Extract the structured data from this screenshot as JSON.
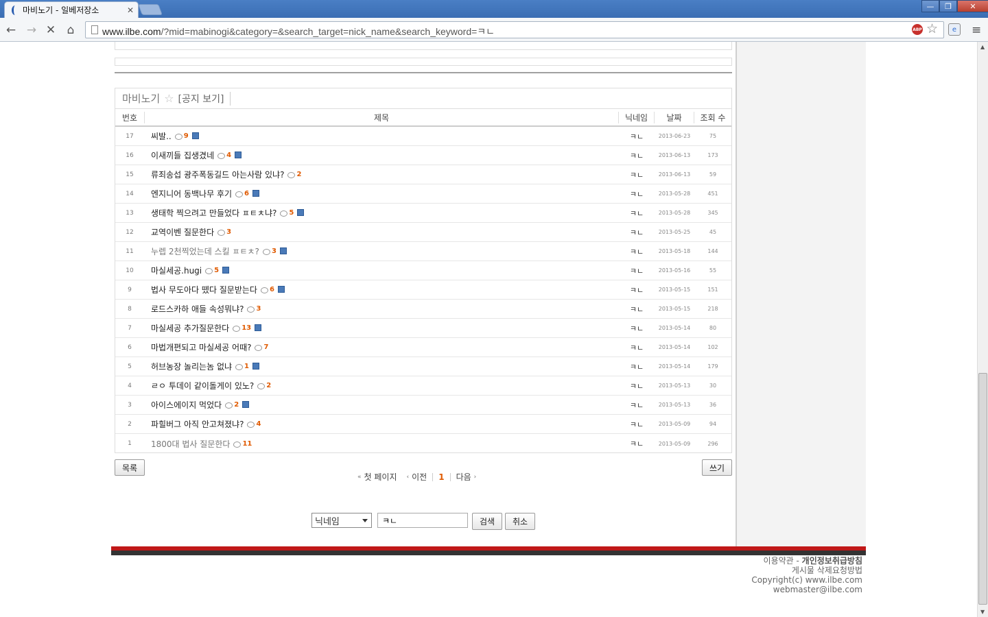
{
  "browser": {
    "tab_title": "마비노기 - 일베저장소",
    "tab_close": "✕",
    "url_host": "www.ilbe.com",
    "url_rest": "/?mid=mabinogi&category=&search_target=nick_name&search_keyword=ㅋㄴ",
    "abp_label": "ABP",
    "window_controls": [
      "—",
      "❐",
      "✕"
    ]
  },
  "board": {
    "name": "마비노기",
    "notice_link": "[공지 보기]",
    "columns": {
      "no": "번호",
      "title": "제목",
      "nick": "닉네임",
      "date": "날짜",
      "views": "조회 수"
    },
    "rows": [
      {
        "no": "17",
        "title": "씨발..",
        "comments": "9",
        "file": true,
        "nick": "ㅋㄴ",
        "date": "2013-06-23",
        "views": "75",
        "visited": false
      },
      {
        "no": "16",
        "title": "이새끼들 집생겼네",
        "comments": "4",
        "file": true,
        "nick": "ㅋㄴ",
        "date": "2013-06-13",
        "views": "173",
        "visited": false
      },
      {
        "no": "15",
        "title": "류죄송섭 광주폭동길드 아는사람 있냐?",
        "comments": "2",
        "file": false,
        "nick": "ㅋㄴ",
        "date": "2013-06-13",
        "views": "59",
        "visited": false
      },
      {
        "no": "14",
        "title": "엔지니어 동백나무 후기",
        "comments": "6",
        "file": true,
        "nick": "ㅋㄴ",
        "date": "2013-05-28",
        "views": "451",
        "visited": false
      },
      {
        "no": "13",
        "title": "생태학 찍으려고 만들었다 ㅍㅌㅊ냐?",
        "comments": "5",
        "file": true,
        "nick": "ㅋㄴ",
        "date": "2013-05-28",
        "views": "345",
        "visited": false
      },
      {
        "no": "12",
        "title": "교역이벤 질문한다",
        "comments": "3",
        "file": false,
        "nick": "ㅋㄴ",
        "date": "2013-05-25",
        "views": "45",
        "visited": false
      },
      {
        "no": "11",
        "title": "누렙 2천찍었는데 스킬 ㅍㅌㅊ?",
        "comments": "3",
        "file": true,
        "nick": "ㅋㄴ",
        "date": "2013-05-18",
        "views": "144",
        "visited": true
      },
      {
        "no": "10",
        "title": "마실세공.hugi",
        "comments": "5",
        "file": true,
        "nick": "ㅋㄴ",
        "date": "2013-05-16",
        "views": "55",
        "visited": false
      },
      {
        "no": "9",
        "title": "법사 무도아다 뗐다 질문받는다",
        "comments": "6",
        "file": true,
        "nick": "ㅋㄴ",
        "date": "2013-05-15",
        "views": "151",
        "visited": false
      },
      {
        "no": "8",
        "title": "로드스카하 애들 속성뭐냐?",
        "comments": "3",
        "file": false,
        "nick": "ㅋㄴ",
        "date": "2013-05-15",
        "views": "218",
        "visited": false
      },
      {
        "no": "7",
        "title": "마실세공 추가질문한다",
        "comments": "13",
        "file": true,
        "nick": "ㅋㄴ",
        "date": "2013-05-14",
        "views": "80",
        "visited": false
      },
      {
        "no": "6",
        "title": "마법개편되고 마실세공 어때?",
        "comments": "7",
        "file": false,
        "nick": "ㅋㄴ",
        "date": "2013-05-14",
        "views": "102",
        "visited": false
      },
      {
        "no": "5",
        "title": "허브농장 놀리는놈 없냐",
        "comments": "1",
        "file": true,
        "nick": "ㅋㄴ",
        "date": "2013-05-14",
        "views": "179",
        "visited": false
      },
      {
        "no": "4",
        "title": "ㄹㅇ 투데이 같이돌게이 있노?",
        "comments": "2",
        "file": false,
        "nick": "ㅋㄴ",
        "date": "2013-05-13",
        "views": "30",
        "visited": false
      },
      {
        "no": "3",
        "title": "아이스에이지 먹었다",
        "comments": "2",
        "file": true,
        "nick": "ㅋㄴ",
        "date": "2013-05-13",
        "views": "36",
        "visited": false
      },
      {
        "no": "2",
        "title": "파힐버그 아직 안고쳐졌냐?",
        "comments": "4",
        "file": false,
        "nick": "ㅋㄴ",
        "date": "2013-05-09",
        "views": "94",
        "visited": false
      },
      {
        "no": "1",
        "title": "1800대 법사 질문한다",
        "comments": "11",
        "file": false,
        "nick": "ㅋㄴ",
        "date": "2013-05-09",
        "views": "296",
        "visited": true
      }
    ]
  },
  "buttons": {
    "list": "목록",
    "write": "쓰기",
    "search": "검색",
    "cancel": "취소"
  },
  "pager": {
    "first": "첫 페이지",
    "prev": "이전",
    "current": "1",
    "next": "다음"
  },
  "search": {
    "target": "닉네임",
    "keyword": "ㅋㄴ"
  },
  "footer": {
    "terms": "이용약관",
    "privacy": "개인정보취급방침",
    "delete_request": "게시물 삭제요청방법",
    "copyright": "Copyright(c) www.ilbe.com",
    "email": "webmaster@ilbe.com"
  },
  "colors": {
    "accent_orange": "#e05a00",
    "footer_red": "#c01818",
    "footer_dark": "#333333",
    "file_icon": "#4a7ab8"
  }
}
